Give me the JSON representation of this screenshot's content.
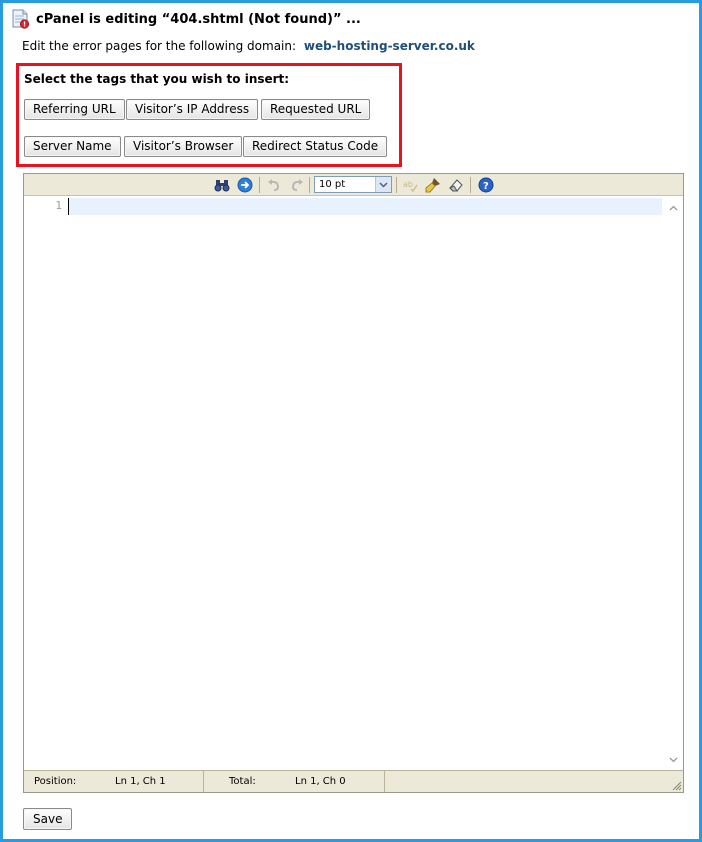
{
  "header": {
    "title": "cPanel is editing “404.shtml (Not found)” ...",
    "icon": "document-error-icon"
  },
  "domain_line": {
    "prefix": "Edit the error pages for the following domain:",
    "domain": "web-hosting-server.co.uk",
    "domain_color": "#1f4e7a"
  },
  "tags": {
    "heading": "Select the tags that you wish to insert:",
    "highlight_color": "#e8131f",
    "buttons": [
      {
        "label": "Referring URL"
      },
      {
        "label": "Visitor’s IP Address"
      },
      {
        "label": "Requested URL"
      },
      {
        "label": "Server Name"
      },
      {
        "label": "Visitor’s Browser"
      },
      {
        "label": "Redirect Status Code"
      }
    ]
  },
  "toolbar": {
    "icons": [
      "search-binoculars-icon",
      "goto-line-icon",
      "undo-icon",
      "redo-icon",
      "spellcheck-icon",
      "highlight-brush-icon",
      "eraser-icon",
      "help-icon"
    ],
    "font_size": "10 pt"
  },
  "editor": {
    "line_numbers": [
      "1"
    ],
    "content": ""
  },
  "status": {
    "position_label": "Position:",
    "position_value": "Ln 1, Ch 1",
    "total_label": "Total:",
    "total_value": "Ln 1, Ch 0"
  },
  "actions": {
    "save_label": "Save"
  },
  "colors": {
    "frame": "#2b9be0",
    "toolbar_bg": "#ece9d8",
    "active_line": "#e8f2fe"
  }
}
